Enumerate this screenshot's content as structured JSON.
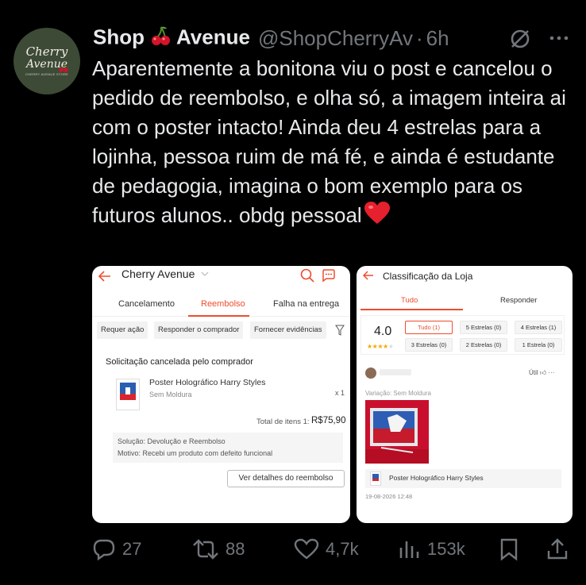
{
  "tweet": {
    "avatar": {
      "line1": "Cherry",
      "line2": "Avenue",
      "line3": "CHERRY AVENUE STORE"
    },
    "display_name_part1": "Shop",
    "display_name_part2": "Avenue",
    "handle": "@ShopCherryAv",
    "separator": "·",
    "time": "6h",
    "text": "Aparentemente a bonitona viu o post e cancelou o pedido de reembolso, e olha só, a imagem inteira ai com o poster intacto! Ainda deu 4 estrelas para a lojinha, pessoa ruim de má fé, e ainda é estudante de pedagogia, imagina o bom exemplo para os futuros alunos.. obdg pessoal",
    "icons": [
      "cherry-icon",
      "grok-icon",
      "more-icon",
      "heart-icon"
    ]
  },
  "left_screen": {
    "title": "Cherry Avenue",
    "tabs": [
      "Cancelamento",
      "Reembolso",
      "Falha na entrega"
    ],
    "active_tab": "Reembolso",
    "chips": [
      "Requer ação",
      "Responder o comprador",
      "Fornecer evidências"
    ],
    "card_title": "Solicitação cancelada pelo comprador",
    "product_name": "Poster Holográfico Harry Styles",
    "product_variant": "Sem Moldura",
    "quantity": "x 1",
    "total_label": "Total de itens 1:",
    "total_value": "R$75,90",
    "solution": "Solução: Devolução e Reembolso",
    "reason": "Motivo: Recebi um produto com defeito funcional",
    "details_button": "Ver detalhes do reembolso"
  },
  "right_screen": {
    "title": "Classificação da Loja",
    "tabs": [
      "Tudo",
      "Responder"
    ],
    "active_tab": "Tudo",
    "rating": "4.0",
    "stars_filled": 4,
    "stars_total": 5,
    "filters": [
      "Tudo (1)",
      "5 Estrelas (0)",
      "4 Estrelas (1)",
      "3 Estrelas (0)",
      "2 Estrelas (0)",
      "1 Estrela (0)"
    ],
    "active_filter": "Tudo (1)",
    "review_util": "Útil",
    "review_variant": "Variação: Sem Moldura",
    "review_product": "Poster Holográfico Harry Styles",
    "review_date": "19-08-2026 12:48"
  },
  "actions": {
    "replies": "27",
    "reposts": "88",
    "likes": "4,7k",
    "views": "153k"
  },
  "colors": {
    "background": "#000000",
    "text": "#e7e9ea",
    "muted": "#71767b",
    "shopee_orange": "#ee4d2d",
    "heart_red": "#e0245e"
  }
}
